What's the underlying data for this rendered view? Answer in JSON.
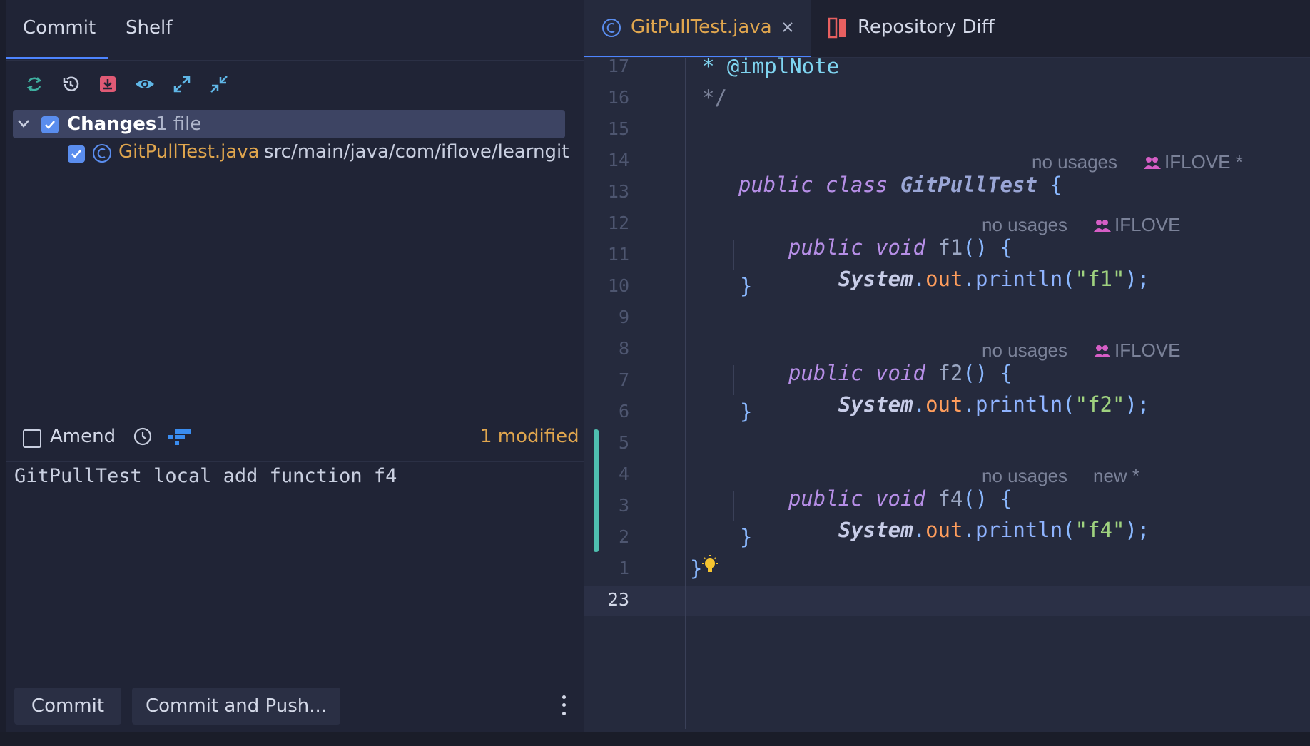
{
  "left_panel": {
    "tabs": [
      {
        "label": "Commit"
      },
      {
        "label": "Shelf"
      }
    ],
    "toolbar": {
      "icons": [
        "refresh-icon",
        "rollback-icon",
        "update-icon",
        "eye-icon",
        "expand-icon",
        "collapse-icon"
      ]
    },
    "changes": {
      "group_label": "Changes",
      "group_count": "1 file",
      "files": [
        {
          "name": "GitPullTest.java",
          "path": "src/main/java/com/iflove/learngit"
        }
      ]
    },
    "amend": {
      "label": "Amend",
      "modified": "1 modified"
    },
    "commit_message": "GitPullTest local add function f4",
    "buttons": {
      "commit": "Commit",
      "commit_push": "Commit and Push..."
    }
  },
  "editor": {
    "tabs": [
      {
        "label": "GitPullTest.java",
        "active": true
      },
      {
        "label": "Repository Diff",
        "active": false
      }
    ],
    "line_numbers": [
      "17",
      "16",
      "15",
      "14",
      "13",
      "12",
      "11",
      "10",
      "9",
      "8",
      "7",
      "6",
      "5",
      "4",
      "3",
      "2",
      "1",
      "23"
    ],
    "code": {
      "l17": "* @implNote",
      "l16": "*/",
      "l14": {
        "kw": "public class",
        "name": "GitPullTest",
        "brace": "{"
      },
      "l12": {
        "kw": "public void",
        "name": "f1",
        "paren": "() {"
      },
      "l11": {
        "cls": "System",
        "dot": ".",
        "fld": "out",
        "dot2": ".",
        "mth": "println",
        "open": "(",
        "str": "\"f1\"",
        "close": ");"
      },
      "l10": "}",
      "l8": {
        "kw": "public void",
        "name": "f2",
        "paren": "() {"
      },
      "l7": {
        "cls": "System",
        "dot": ".",
        "fld": "out",
        "dot2": ".",
        "mth": "println",
        "open": "(",
        "str": "\"f2\"",
        "close": ");"
      },
      "l6": "}",
      "l4": {
        "kw": "public void",
        "name": "f4",
        "paren": "() {"
      },
      "l3": {
        "cls": "System",
        "dot": ".",
        "fld": "out",
        "dot2": ".",
        "mth": "println",
        "open": "(",
        "str": "\"f4\"",
        "close": ");"
      },
      "l2": "}",
      "l1": "}"
    },
    "hints": {
      "no_usages": "no usages",
      "author_star": "IFLOVE *",
      "author": "IFLOVE",
      "new_star": "new *"
    }
  },
  "colors": {
    "accent": "#4d84ff",
    "changed": "#4fbfb0",
    "modified": "#e0a64e"
  }
}
